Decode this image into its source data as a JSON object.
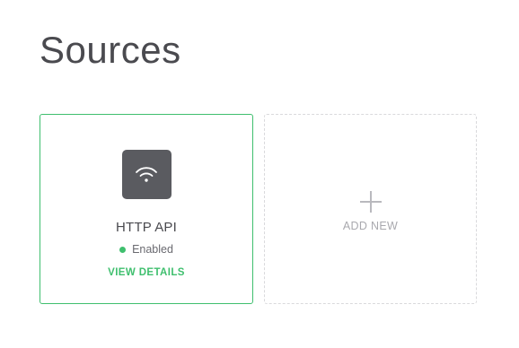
{
  "header": {
    "title": "Sources"
  },
  "sources": [
    {
      "name": "HTTP API",
      "icon": "wifi-icon",
      "status": "Enabled",
      "status_color": "#3fbf6e",
      "details_label": "VIEW DETAILS"
    }
  ],
  "add_new": {
    "icon": "plus-icon",
    "label": "ADD NEW"
  },
  "colors": {
    "accent": "#3fbf6e",
    "icon_tile": "#5a5b60",
    "title_text": "#4a4a4f"
  }
}
